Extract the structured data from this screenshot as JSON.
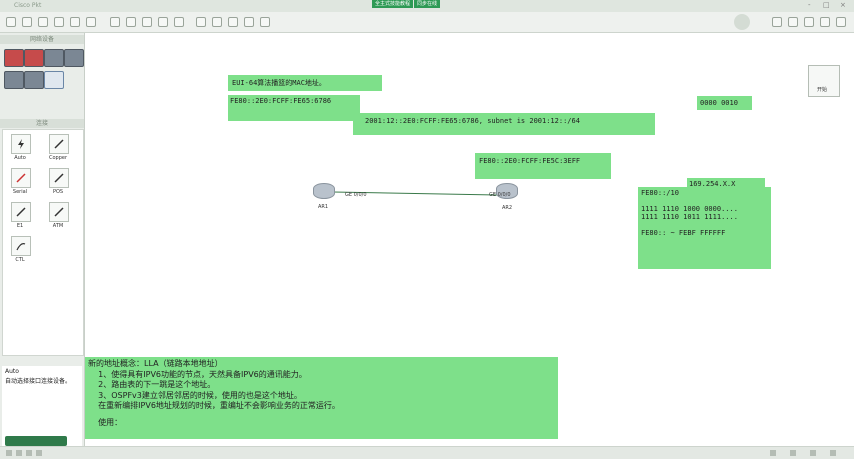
{
  "titlebar": {
    "app_title": "Cisco Pkt",
    "tab_a": "全主式技能教程",
    "tab_b": "同步在线",
    "controls": [
      "-",
      "□",
      "×"
    ]
  },
  "palette": {
    "section_devices": "网络设备",
    "section_links": "连接",
    "links": [
      {
        "label": "Auto",
        "icon": "lightning-icon"
      },
      {
        "label": "Copper",
        "icon": "straight-cable-icon"
      },
      {
        "label": "Serial",
        "icon": "serial-cable-icon"
      },
      {
        "label": "POS",
        "icon": "pos-cable-icon"
      },
      {
        "label": "E1",
        "icon": "e1-cable-icon"
      },
      {
        "label": "ATM",
        "icon": "atm-cable-icon"
      },
      {
        "label": "CTL",
        "icon": "console-cable-icon"
      }
    ],
    "desc_title": "Auto",
    "desc_text": "自动选择接口连接设备。"
  },
  "workspace": {
    "eui_title": "EUI-64算法播篮的MAC地址。",
    "fe80_r1": "FE80::2E0:FCFF:FE65:6786",
    "global_addr": "2001:12::2E0:FCFF:FE65:6786, subnet is 2001:12::/64",
    "binary_right": "0000 0010",
    "fe80_r2": "FE80::2E0:FCFF:FE5C:3EFF",
    "apipa": "169.254.X.X",
    "lla_box": [
      "FE80::/10",
      "",
      "1111 1110 1000 0000....",
      "1111 1110 1011 1111....",
      "",
      "FE80:: ~ FEBF FFFFFF"
    ],
    "router1_label": "AR1",
    "router2_label": "AR2",
    "port1": "GE 0/0/0",
    "port2": "GE 0/0/0",
    "side_widget_label": "开始",
    "notes": [
      "新的地址概念：LLA（链路本地地址）",
      "    1、使得具有IPV6功能的节点，天然具备IPV6的通讯能力。",
      "    2、路由表的下一跳是这个地址。",
      "    3、OSPFv3建立邻居邻居的时候，使用的也是这个地址。",
      "    在重新编排IPV6地址规划的时候，重编址不会影响业务的正常运行。",
      "",
      "    使用："
    ]
  },
  "colors": {
    "note_green": "#7ee08a",
    "accent": "#2e9a55"
  }
}
